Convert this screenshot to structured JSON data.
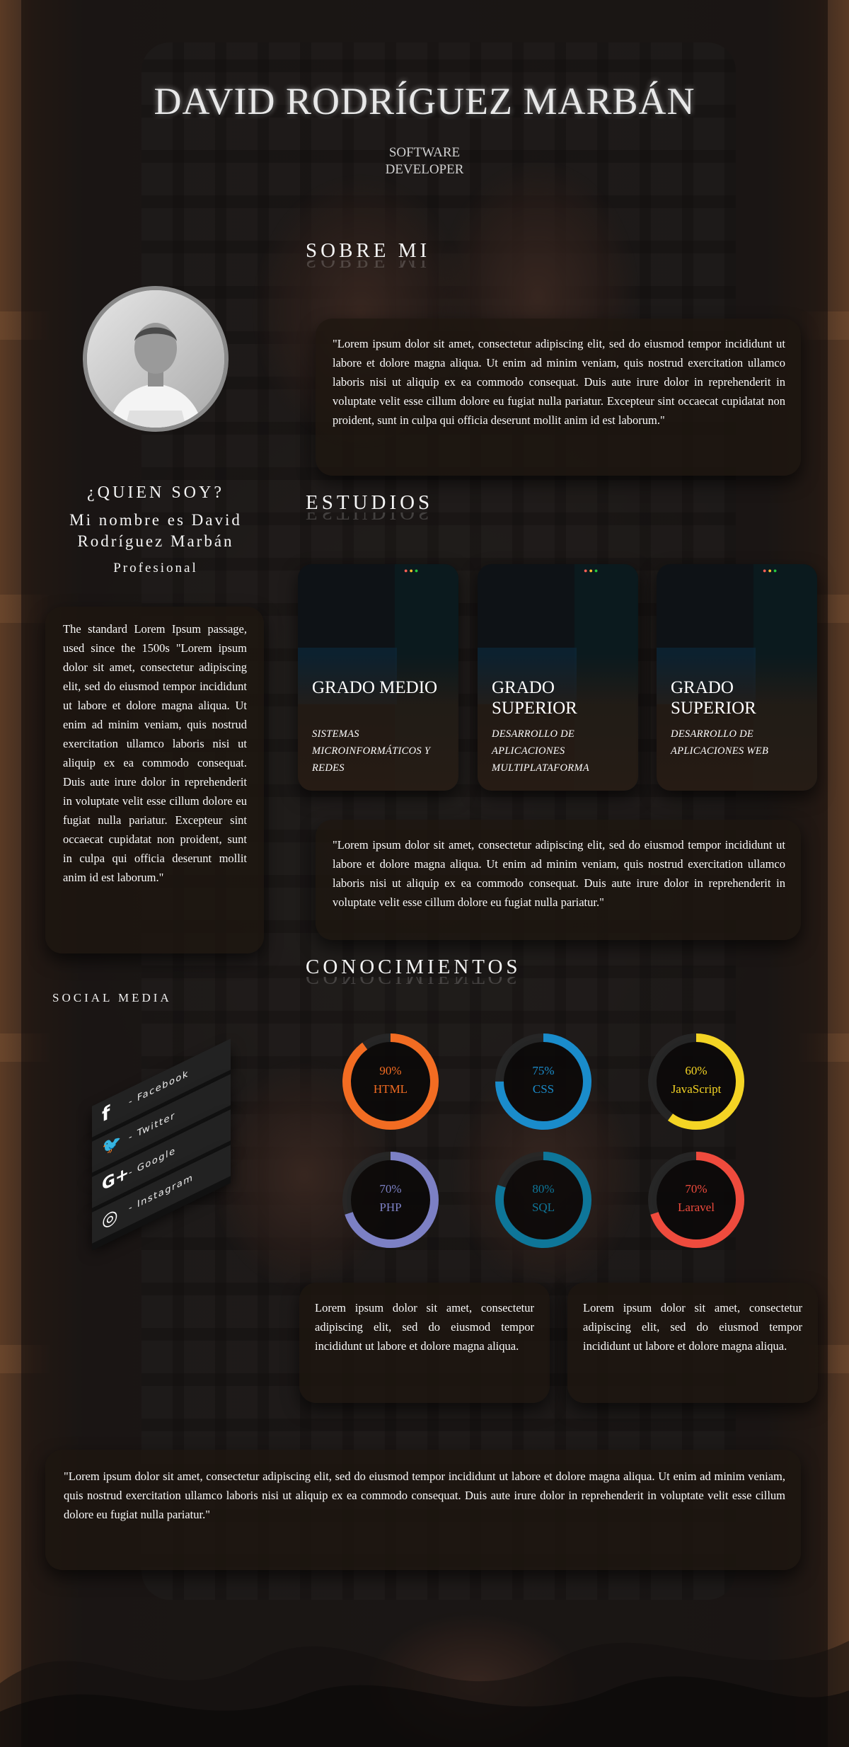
{
  "header": {
    "name": "DAVID RODRÍGUEZ MARBÁN",
    "role_line1": "SOFTWARE",
    "role_line2": "DEVELOPER"
  },
  "profile": {
    "who_title": "¿QUIEN SOY?",
    "name_line1": "Mi nombre es David",
    "name_line2": "Rodríguez Marbán",
    "tag": "Profesional",
    "bio": "The standard Lorem Ipsum passage, used since the 1500s \"Lorem ipsum dolor sit amet, consectetur adipiscing elit, sed do eiusmod tempor incididunt ut labore et dolore magna aliqua. Ut enim ad minim veniam, quis nostrud exercitation ullamco laboris nisi ut aliquip ex ea commodo consequat. Duis aute irure dolor in reprehenderit in voluptate velit esse cillum dolore eu fugiat nulla pariatur. Excepteur sint occaecat cupidatat non proident, sunt in culpa qui officia deserunt mollit anim id est laborum.\""
  },
  "about": {
    "heading": "SOBRE MI",
    "text": "\"Lorem ipsum dolor sit amet, consectetur adipiscing elit, sed do eiusmod tempor incididunt ut labore et dolore magna aliqua. Ut enim ad minim veniam, quis nostrud exercitation ullamco laboris nisi ut aliquip ex ea commodo consequat. Duis aute irure dolor in reprehenderit in voluptate velit esse cillum dolore eu fugiat nulla pariatur. Excepteur sint occaecat cupidatat non proident, sunt in culpa qui officia deserunt mollit anim id est laborum.\""
  },
  "studies": {
    "heading": "ESTUDIOS",
    "items": [
      {
        "title": "GRADO MEDIO",
        "desc": "SISTEMAS MICROINFORMÁTICOS Y REDES"
      },
      {
        "title": "GRADO SUPERIOR",
        "desc": "DESARROLLO DE APLICACIONES MULTIPLATAFORMA"
      },
      {
        "title": "GRADO SUPERIOR",
        "desc": "DESARROLLO DE APLICACIONES WEB"
      }
    ],
    "text": "\"Lorem ipsum dolor sit amet, consectetur adipiscing elit, sed do eiusmod tempor incididunt ut labore et dolore magna aliqua. Ut enim ad minim veniam, quis nostrud exercitation ullamco laboris nisi ut aliquip ex ea commodo consequat. Duis aute irure dolor in reprehenderit in voluptate velit esse cillum dolore eu fugiat nulla pariatur.\""
  },
  "skills": {
    "heading": "CONOCIMIENTOS",
    "items": [
      {
        "name": "HTML",
        "percent_label": "90%",
        "value": 90,
        "color": "#f26c22",
        "text_color": "#f26c22"
      },
      {
        "name": "CSS",
        "percent_label": "75%",
        "value": 75,
        "color": "#1a8ccb",
        "text_color": "#1a8ccb"
      },
      {
        "name": "JavaScript",
        "percent_label": "60%",
        "value": 60,
        "color": "#f4d424",
        "text_color": "#f4d424"
      },
      {
        "name": "PHP",
        "percent_label": "70%",
        "value": 70,
        "color": "#7c80c4",
        "text_color": "#7c80c4"
      },
      {
        "name": "SQL",
        "percent_label": "80%",
        "value": 80,
        "color": "#0e7699",
        "text_color": "#0e7699"
      },
      {
        "name": "Laravel",
        "percent_label": "70%",
        "value": 70,
        "color": "#ef4b3d",
        "text_color": "#ef4b3d"
      }
    ],
    "note_left": "Lorem ipsum dolor sit amet, consectetur adipiscing elit, sed do eiusmod tempor incididunt ut labore et dolore magna aliqua.",
    "note_right": "Lorem ipsum dolor sit amet, consectetur adipiscing elit, sed do eiusmod tempor incididunt ut labore et dolore magna aliqua."
  },
  "social": {
    "heading": "SOCIAL MEDIA",
    "items": [
      {
        "icon": "facebook-icon",
        "glyph": "f",
        "label": "- Facebook"
      },
      {
        "icon": "twitter-icon",
        "glyph": "🐦",
        "label": "- Twitter"
      },
      {
        "icon": "google-plus-icon",
        "glyph": "G+",
        "label": "- Google"
      },
      {
        "icon": "instagram-icon",
        "glyph": "◎",
        "label": "- Instagram"
      }
    ]
  },
  "footer": {
    "text": "\"Lorem ipsum dolor sit amet, consectetur adipiscing elit, sed do eiusmod tempor incididunt ut labore et dolore magna aliqua. Ut enim ad minim veniam, quis nostrud exercitation ullamco laboris nisi ut aliquip ex ea commodo consequat. Duis aute irure dolor in reprehenderit in voluptate velit esse cillum dolore eu fugiat nulla pariatur.\""
  }
}
